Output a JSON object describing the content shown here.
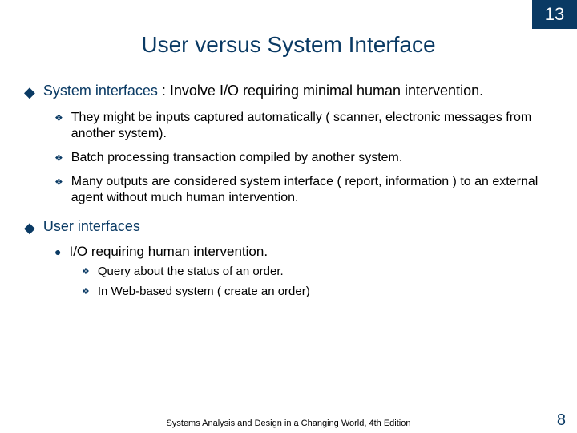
{
  "chapter": "13",
  "title": "User versus System Interface",
  "bullets": [
    {
      "lead": "System interfaces",
      "rest": " : Involve I/O requiring minimal human intervention.",
      "subtype": "diamond",
      "subs": [
        "They might be inputs captured automatically ( scanner, electronic messages from another system).",
        "Batch processing transaction compiled by another system.",
        "Many outputs are considered system interface ( report, information ) to an external agent without much human intervention."
      ]
    },
    {
      "lead": "User interfaces",
      "rest": "",
      "subtype": "disc",
      "subs_nested": [
        {
          "text": "I/O requiring human intervention.",
          "subs": [
            "Query about the status of an order.",
            "In Web-based system ( create an order)"
          ]
        }
      ]
    }
  ],
  "footer": "Systems Analysis and Design in a Changing World, 4th Edition",
  "page": "8"
}
